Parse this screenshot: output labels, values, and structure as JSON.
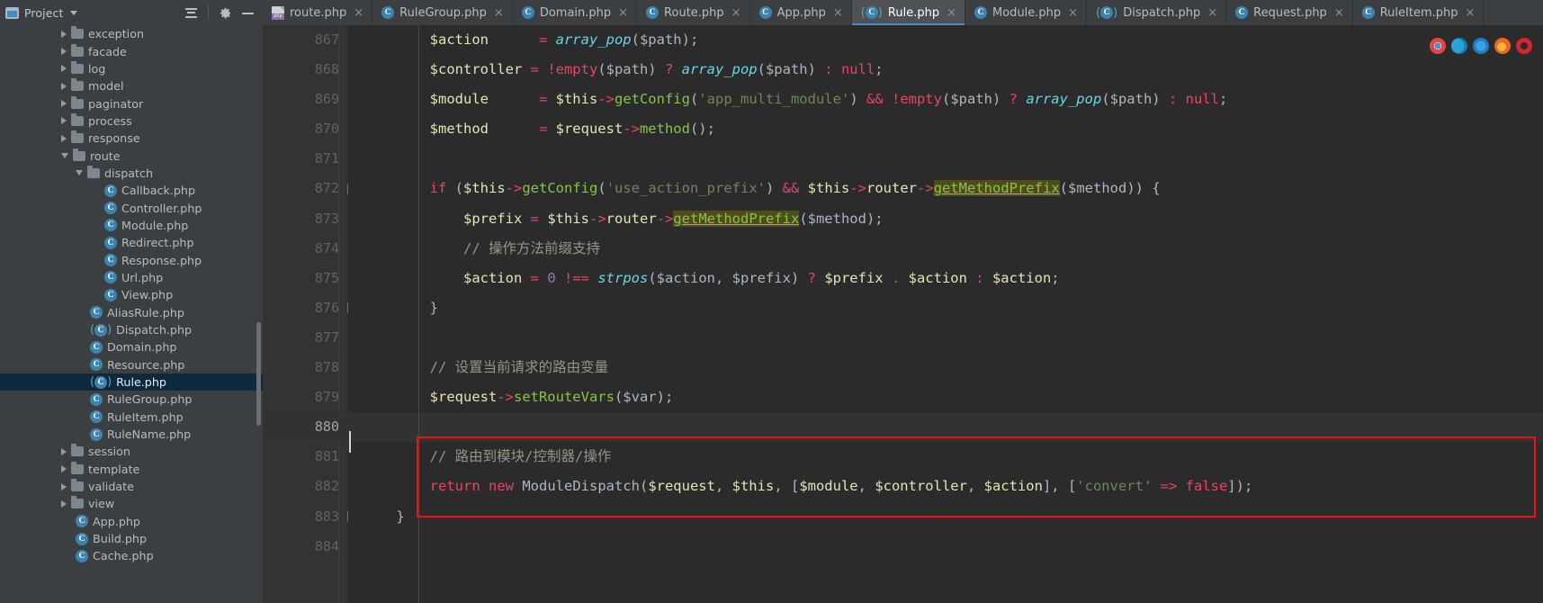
{
  "window": {
    "project_panel": {
      "title": "Project",
      "icons": [
        "project-icon",
        "caret-down-icon",
        "collapse-all-icon",
        "gear-icon",
        "minimize-icon"
      ]
    }
  },
  "tabs": [
    {
      "label": "route.php",
      "icon": "php-file-icon",
      "active": false
    },
    {
      "label": "RuleGroup.php",
      "icon": "php-class-icon",
      "active": false
    },
    {
      "label": "Domain.php",
      "icon": "php-class-icon",
      "active": false
    },
    {
      "label": "Route.php",
      "icon": "php-class-icon",
      "active": false
    },
    {
      "label": "App.php",
      "icon": "php-class-icon",
      "active": false
    },
    {
      "label": "Rule.php",
      "icon": "php-abstract-icon",
      "active": true
    },
    {
      "label": "Module.php",
      "icon": "php-class-icon",
      "active": false
    },
    {
      "label": "Dispatch.php",
      "icon": "php-abstract-icon",
      "active": false
    },
    {
      "label": "Request.php",
      "icon": "php-class-icon",
      "active": false
    },
    {
      "label": "RuleItem.php",
      "icon": "php-class-icon",
      "active": false
    }
  ],
  "tab_close_glyph": "×",
  "sidebar": {
    "items": [
      {
        "label": "exception",
        "indent": 1,
        "kind": "folder",
        "state": "closed"
      },
      {
        "label": "facade",
        "indent": 1,
        "kind": "folder",
        "state": "closed"
      },
      {
        "label": "log",
        "indent": 1,
        "kind": "folder",
        "state": "closed"
      },
      {
        "label": "model",
        "indent": 1,
        "kind": "folder",
        "state": "closed"
      },
      {
        "label": "paginator",
        "indent": 1,
        "kind": "folder",
        "state": "closed"
      },
      {
        "label": "process",
        "indent": 1,
        "kind": "folder",
        "state": "closed"
      },
      {
        "label": "response",
        "indent": 1,
        "kind": "folder",
        "state": "closed"
      },
      {
        "label": "route",
        "indent": 1,
        "kind": "folder",
        "state": "open"
      },
      {
        "label": "dispatch",
        "indent": 2,
        "kind": "folder",
        "state": "open"
      },
      {
        "label": "Callback.php",
        "indent": 4,
        "kind": "class"
      },
      {
        "label": "Controller.php",
        "indent": 4,
        "kind": "class"
      },
      {
        "label": "Module.php",
        "indent": 4,
        "kind": "class"
      },
      {
        "label": "Redirect.php",
        "indent": 4,
        "kind": "class"
      },
      {
        "label": "Response.php",
        "indent": 4,
        "kind": "class"
      },
      {
        "label": "Url.php",
        "indent": 4,
        "kind": "class"
      },
      {
        "label": "View.php",
        "indent": 4,
        "kind": "class"
      },
      {
        "label": "AliasRule.php",
        "indent": 3,
        "kind": "class"
      },
      {
        "label": "Dispatch.php",
        "indent": 3,
        "kind": "abstract"
      },
      {
        "label": "Domain.php",
        "indent": 3,
        "kind": "class"
      },
      {
        "label": "Resource.php",
        "indent": 3,
        "kind": "class"
      },
      {
        "label": "Rule.php",
        "indent": 3,
        "kind": "abstract",
        "selected": true
      },
      {
        "label": "RuleGroup.php",
        "indent": 3,
        "kind": "class"
      },
      {
        "label": "RuleItem.php",
        "indent": 3,
        "kind": "class"
      },
      {
        "label": "RuleName.php",
        "indent": 3,
        "kind": "class"
      },
      {
        "label": "session",
        "indent": 1,
        "kind": "folder",
        "state": "closed"
      },
      {
        "label": "template",
        "indent": 1,
        "kind": "folder",
        "state": "closed"
      },
      {
        "label": "validate",
        "indent": 1,
        "kind": "folder",
        "state": "closed"
      },
      {
        "label": "view",
        "indent": 1,
        "kind": "folder",
        "state": "closed"
      },
      {
        "label": "App.php",
        "indent": 2,
        "kind": "class"
      },
      {
        "label": "Build.php",
        "indent": 2,
        "kind": "class"
      },
      {
        "label": "Cache.php",
        "indent": 2,
        "kind": "class"
      }
    ]
  },
  "editor": {
    "first_line": 867,
    "current_line": 880,
    "lines": [
      {
        "n": 867,
        "fold": null,
        "tokens": [
          {
            "t": "        ",
            "c": "s-plain"
          },
          {
            "t": "$action",
            "c": "s-var"
          },
          {
            "t": "      = ",
            "c": "s-op"
          },
          {
            "t": "array_pop",
            "c": "s-fn"
          },
          {
            "t": "($path);",
            "c": "s-plain"
          }
        ]
      },
      {
        "n": 868,
        "fold": null,
        "tokens": [
          {
            "t": "        ",
            "c": "s-plain"
          },
          {
            "t": "$controller",
            "c": "s-var"
          },
          {
            "t": " = ",
            "c": "s-op"
          },
          {
            "t": "!empty",
            "c": "s-kw"
          },
          {
            "t": "($path) ",
            "c": "s-plain"
          },
          {
            "t": "? ",
            "c": "s-op"
          },
          {
            "t": "array_pop",
            "c": "s-fn"
          },
          {
            "t": "($path) ",
            "c": "s-plain"
          },
          {
            "t": ": ",
            "c": "s-op"
          },
          {
            "t": "null",
            "c": "s-null"
          },
          {
            "t": ";",
            "c": "s-plain"
          }
        ]
      },
      {
        "n": 869,
        "fold": null,
        "tokens": [
          {
            "t": "        ",
            "c": "s-plain"
          },
          {
            "t": "$module",
            "c": "s-var"
          },
          {
            "t": "      = ",
            "c": "s-op"
          },
          {
            "t": "$this",
            "c": "s-var"
          },
          {
            "t": "->",
            "c": "s-op"
          },
          {
            "t": "getConfig",
            "c": "s-meth"
          },
          {
            "t": "(",
            "c": "s-plain"
          },
          {
            "t": "'app_multi_module'",
            "c": "s-str"
          },
          {
            "t": ") ",
            "c": "s-plain"
          },
          {
            "t": "&& ",
            "c": "s-op"
          },
          {
            "t": "!empty",
            "c": "s-kw"
          },
          {
            "t": "($path) ",
            "c": "s-plain"
          },
          {
            "t": "? ",
            "c": "s-op"
          },
          {
            "t": "array_pop",
            "c": "s-fn"
          },
          {
            "t": "($path) ",
            "c": "s-plain"
          },
          {
            "t": ": ",
            "c": "s-op"
          },
          {
            "t": "null",
            "c": "s-null"
          },
          {
            "t": ";",
            "c": "s-plain"
          }
        ]
      },
      {
        "n": 870,
        "fold": null,
        "tokens": [
          {
            "t": "        ",
            "c": "s-plain"
          },
          {
            "t": "$method",
            "c": "s-var"
          },
          {
            "t": "      = ",
            "c": "s-op"
          },
          {
            "t": "$request",
            "c": "s-var"
          },
          {
            "t": "->",
            "c": "s-op"
          },
          {
            "t": "method",
            "c": "s-meth"
          },
          {
            "t": "();",
            "c": "s-plain"
          }
        ]
      },
      {
        "n": 871,
        "fold": null,
        "tokens": []
      },
      {
        "n": 872,
        "fold": "minus",
        "tokens": [
          {
            "t": "        ",
            "c": "s-plain"
          },
          {
            "t": "if",
            "c": "s-kw"
          },
          {
            "t": " (",
            "c": "s-plain"
          },
          {
            "t": "$this",
            "c": "s-var"
          },
          {
            "t": "->",
            "c": "s-op"
          },
          {
            "t": "getConfig",
            "c": "s-meth"
          },
          {
            "t": "(",
            "c": "s-plain"
          },
          {
            "t": "'use_action_prefix'",
            "c": "s-str"
          },
          {
            "t": ") ",
            "c": "s-plain"
          },
          {
            "t": "&& ",
            "c": "s-op"
          },
          {
            "t": "$this",
            "c": "s-var"
          },
          {
            "t": "->",
            "c": "s-op"
          },
          {
            "t": "router",
            "c": "s-var"
          },
          {
            "t": "->",
            "c": "s-op"
          },
          {
            "t": "getMethodPrefix",
            "c": "s-meth hl-usage u"
          },
          {
            "t": "($method)) {",
            "c": "s-plain"
          }
        ]
      },
      {
        "n": 873,
        "fold": null,
        "tokens": [
          {
            "t": "            ",
            "c": "s-plain"
          },
          {
            "t": "$prefix",
            "c": "s-var"
          },
          {
            "t": " = ",
            "c": "s-op"
          },
          {
            "t": "$this",
            "c": "s-var"
          },
          {
            "t": "->",
            "c": "s-op"
          },
          {
            "t": "router",
            "c": "s-var"
          },
          {
            "t": "->",
            "c": "s-op"
          },
          {
            "t": "getMethodPrefix",
            "c": "s-meth hl-usage u"
          },
          {
            "t": "($method);",
            "c": "s-plain"
          }
        ]
      },
      {
        "n": 874,
        "fold": null,
        "tokens": [
          {
            "t": "            ",
            "c": "s-plain"
          },
          {
            "t": "// 操作方法前缀支持",
            "c": "s-cmt-cn"
          }
        ]
      },
      {
        "n": 875,
        "fold": null,
        "tokens": [
          {
            "t": "            ",
            "c": "s-plain"
          },
          {
            "t": "$action",
            "c": "s-var"
          },
          {
            "t": " = ",
            "c": "s-op"
          },
          {
            "t": "0",
            "c": "s-num"
          },
          {
            "t": " !== ",
            "c": "s-op"
          },
          {
            "t": "strpos",
            "c": "s-fn"
          },
          {
            "t": "($action, $prefix) ",
            "c": "s-plain"
          },
          {
            "t": "? ",
            "c": "s-op"
          },
          {
            "t": "$prefix ",
            "c": "s-var"
          },
          {
            "t": ". ",
            "c": "s-op"
          },
          {
            "t": "$action ",
            "c": "s-var"
          },
          {
            "t": ": ",
            "c": "s-op"
          },
          {
            "t": "$action",
            "c": "s-var"
          },
          {
            "t": ";",
            "c": "s-plain"
          }
        ]
      },
      {
        "n": 876,
        "fold": "plus",
        "tokens": [
          {
            "t": "        }",
            "c": "s-plain"
          }
        ]
      },
      {
        "n": 877,
        "fold": null,
        "tokens": []
      },
      {
        "n": 878,
        "fold": null,
        "tokens": [
          {
            "t": "        ",
            "c": "s-plain"
          },
          {
            "t": "// 设置当前请求的路由变量",
            "c": "s-cmt-cn"
          }
        ]
      },
      {
        "n": 879,
        "fold": null,
        "tokens": [
          {
            "t": "        ",
            "c": "s-plain"
          },
          {
            "t": "$request",
            "c": "s-var"
          },
          {
            "t": "->",
            "c": "s-op"
          },
          {
            "t": "setRouteVars",
            "c": "s-meth"
          },
          {
            "t": "($var);",
            "c": "s-plain"
          }
        ]
      },
      {
        "n": 880,
        "fold": null,
        "tokens": [],
        "current": true
      },
      {
        "n": 881,
        "fold": null,
        "tokens": [
          {
            "t": "        ",
            "c": "s-plain"
          },
          {
            "t": "// 路由到模块/控制器/操作",
            "c": "s-cmt-cn"
          }
        ]
      },
      {
        "n": 882,
        "fold": null,
        "tokens": [
          {
            "t": "        ",
            "c": "s-plain"
          },
          {
            "t": "return",
            "c": "s-kw"
          },
          {
            "t": " ",
            "c": "s-plain"
          },
          {
            "t": "new",
            "c": "s-kw"
          },
          {
            "t": " ModuleDispatch(",
            "c": "s-plain"
          },
          {
            "t": "$request",
            "c": "s-var"
          },
          {
            "t": ", ",
            "c": "s-plain"
          },
          {
            "t": "$this",
            "c": "s-var"
          },
          {
            "t": ", [",
            "c": "s-plain"
          },
          {
            "t": "$module",
            "c": "s-var"
          },
          {
            "t": ", ",
            "c": "s-plain"
          },
          {
            "t": "$controller",
            "c": "s-var"
          },
          {
            "t": ", ",
            "c": "s-plain"
          },
          {
            "t": "$action",
            "c": "s-var"
          },
          {
            "t": "], [",
            "c": "s-plain"
          },
          {
            "t": "'convert'",
            "c": "s-str"
          },
          {
            "t": " => ",
            "c": "s-op"
          },
          {
            "t": "false",
            "c": "s-kw"
          },
          {
            "t": "]);",
            "c": "s-plain"
          }
        ]
      },
      {
        "n": 883,
        "fold": "plus",
        "tokens": [
          {
            "t": "    }",
            "c": "s-plain"
          }
        ]
      },
      {
        "n": 884,
        "fold": null,
        "tokens": []
      }
    ],
    "browser_icons": [
      "chrome-icon",
      "edge-icon",
      "ie-icon",
      "firefox-icon",
      "opera-icon"
    ]
  },
  "colors": {
    "accent": "#4a88c7",
    "annotation_red": "#f30f0f",
    "selection_blue": "#0d293e",
    "usage_highlight": "#4f4b1f",
    "editor_bg": "#2b2b2b",
    "gutter_bg": "#313335",
    "panel_bg": "#3c3f41"
  }
}
